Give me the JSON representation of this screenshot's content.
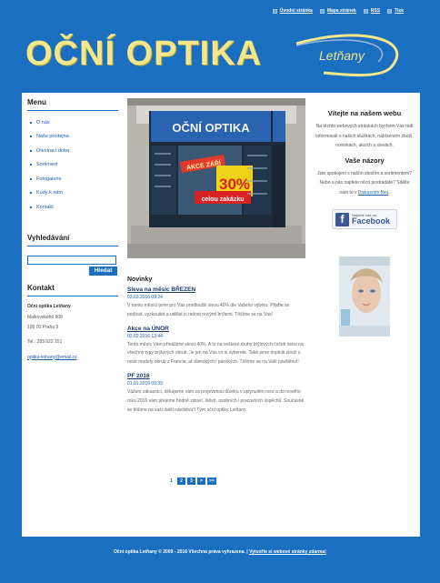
{
  "toplinks": [
    {
      "label": "Úvodní stránka",
      "icon": "home-icon"
    },
    {
      "label": "Mapa stránek",
      "icon": "sitemap-icon"
    },
    {
      "label": "RSS",
      "icon": "rss-icon"
    },
    {
      "label": "Tisk",
      "icon": "print-icon"
    }
  ],
  "logo": {
    "main": "OČNÍ OPTIKA",
    "sub": "Letňany"
  },
  "sidebar": {
    "menu_heading": "Menu",
    "menu": [
      "O nás",
      "Naše prodejna",
      "Otevírací doba",
      "Sortiment",
      "Fotogalerie",
      "Kudy k nám",
      "Kontakt"
    ],
    "search_heading": "Vyhledávání",
    "search_value": "",
    "search_button": "Hledat",
    "contact_heading": "Kontakt",
    "contact": {
      "name": "Oční optika Letňany",
      "street": "Malkovského 608",
      "city": "199 00 Praha 9",
      "phone": "Tel.: 283 922 151",
      "email": "optika-letnany@email.cz"
    }
  },
  "photo": {
    "sign": "OČNÍ OPTIKA",
    "poster_top": "AKCE ZÁŘÍ",
    "poster_pct": "30%",
    "poster_bottom": "celou zakázku"
  },
  "news": {
    "heading": "Novinky",
    "items": [
      {
        "title": "Sleva na měsíc BŘEZEN",
        "date": "03.03.2016 09:24",
        "text": "V tomto měsíci jsme pro Vás prodloužili slevu 40% dle Vašeho výběru. Přijďte se podívat, vyzkoušet a udělat si radost novými brýlemi. Těšíme se na Vás!"
      },
      {
        "title": "Akce na ÚNOR",
        "date": "02.02.2016 13:44",
        "text": "Tento měsíc Vám přinášíme slevu 40%. A to na veškeré druhy brýlových čoček nebo na všechny typy brýlových obrub. Je jen na Vás co si vyberete. Také jsme doplnili zboží o nové modely obrub z Francie, ať dámských i pánských. Těšíme se na Vaši návštěvu!!"
      },
      {
        "title": "PF 2016",
        "date": "01.01.2016 09:39",
        "text": "Vážení zákazníci, děkujeme vám za projevenou důvěru v uplynulém roce a do nového roku 2016 vám přejeme hodně zdraví, štěstí, osobních i pracovních úspěchů. Současně se těšíme na vaši další návštěvu!! Tým oční optiky Letňany"
      }
    ],
    "pager": [
      "1",
      "2",
      "3",
      ">",
      ">>"
    ]
  },
  "right": {
    "welcome_heading": "Vítejte na našem webu",
    "welcome_text": "Na těchto webových stránkách bychom Vás rádi informovali o našich službách, nabízeném zboží, novinkách, akcích a slevách.",
    "opinions_heading": "Vaše názory",
    "opinions_text": "Jste spokojeni s naším zbožím a sortimentem? Nebo u nás najdete něco postrádáte? Sdělte nám to v",
    "opinions_link": "Diskusním fóru",
    "opinions_end": ".",
    "fb_small": "Najdete nás na",
    "fb_big": "Facebook"
  },
  "footer": {
    "copy": "Oční optika Letňany © 2009 - 2016 Všechna práva vyhrazena.",
    "sep": " | ",
    "link": "Vytvořte si webové stránky zdarma!"
  }
}
